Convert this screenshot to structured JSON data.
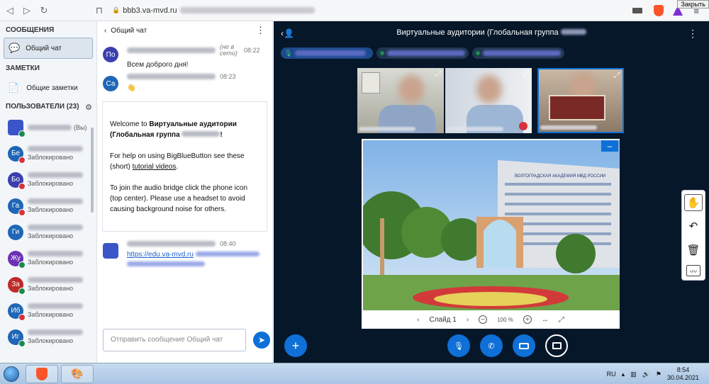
{
  "browser": {
    "url_text": "bbb3.va-mvd.ru",
    "close_tooltip": "Закрыть",
    "notification_count": "1"
  },
  "sidebar": {
    "messages_title": "СООБЩЕНИЯ",
    "public_chat_label": "Общий чат",
    "notes_title": "ЗАМЕТКИ",
    "shared_notes_label": "Общие заметки",
    "users_title": "ПОЛЬЗОВАТЕЛИ (23)",
    "self_suffix": "(Вы)",
    "users": [
      {
        "initials": "",
        "color": "#3a55c8",
        "status": "(Вы)",
        "badge": "green"
      },
      {
        "initials": "Бе",
        "color": "#1f66b6",
        "status": "Заблокировано",
        "badge": "red"
      },
      {
        "initials": "Бо",
        "color": "#3b3fb0",
        "status": "Заблокировано",
        "badge": "red"
      },
      {
        "initials": "Га",
        "color": "#1f66b6",
        "status": "Заблокировано",
        "badge": "red"
      },
      {
        "initials": "Ги",
        "color": "#1f66b6",
        "status": "Заблокировано",
        "badge": "none"
      },
      {
        "initials": "Жу",
        "color": "#6b2fb4",
        "status": "Заблокировано",
        "badge": "green"
      },
      {
        "initials": "За",
        "color": "#bf2a2a",
        "status": "Заблокировано",
        "badge": "green"
      },
      {
        "initials": "Иб",
        "color": "#1f66b6",
        "status": "Заблокировано",
        "badge": "red"
      },
      {
        "initials": "Иг",
        "color": "#1f66b6",
        "status": "Заблокировано",
        "badge": "green"
      }
    ]
  },
  "chat": {
    "title": "Общий чат",
    "messages": [
      {
        "initials": "По",
        "color": "#3b3fb0",
        "offline": "(не в сети)",
        "time": "08:22",
        "text": "Всем доброго дня!"
      },
      {
        "initials": "Са",
        "color": "#1f66b6",
        "offline": "",
        "time": "08:23",
        "text": "👋"
      }
    ],
    "welcome": {
      "line1a": "Welcome to ",
      "line1b": "Виртуальные аудитории (Глобальная группа",
      "line1c": "!",
      "help_a": "For help on using BigBlueButton see these (short) ",
      "help_link": "tutorial videos",
      "help_b": ".",
      "audio": "To join the audio bridge click the phone icon (top center). Please use a headset to avoid causing background noise for others."
    },
    "link_message": {
      "time": "08:40",
      "link": "https://edu.va-mvd.ru"
    },
    "input_placeholder": "Отправить сообщение Общий чат"
  },
  "main": {
    "title": "Виртуальные аудитории (Глобальная группа",
    "slide_label": "Слайд 1",
    "zoom": "100 %",
    "building_sign": "ВОЛГОГРАДСКАЯ АКАДЕМИЯ МВД РОССИИ"
  },
  "taskbar": {
    "lang": "RU",
    "time": "8:54",
    "date": "30.04.2021"
  },
  "colors": {
    "accent": "#0f70d7",
    "main_bg": "#06172a",
    "locked_badge": "#d9323b",
    "green_badge": "#1b8b4d"
  }
}
